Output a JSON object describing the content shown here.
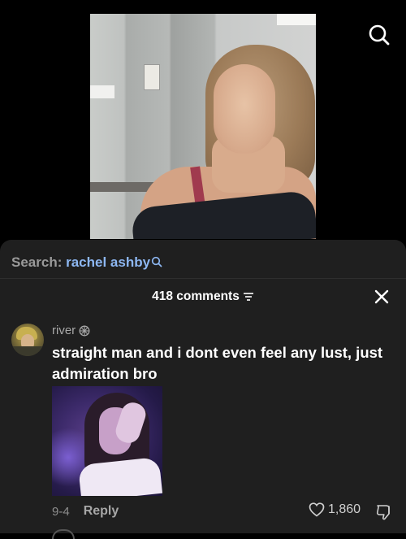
{
  "video": {
    "search_icon": "search-icon"
  },
  "panel": {
    "search_label": "Search:",
    "search_term": "rachel ashby",
    "comments_count": "418 comments",
    "filter_icon": "sort-icon",
    "close_icon": "close-icon"
  },
  "comment": {
    "username": "river",
    "badge_icon": "flower-badge-icon",
    "text": "straight man and i dont even feel any lust, just admiration bro",
    "date": "9-4",
    "reply_label": "Reply",
    "likes": "1,860",
    "like_icon": "heart-icon",
    "dislike_icon": "thumbs-down-icon"
  },
  "colors": {
    "background": "#000000",
    "panel": "#1f1f1f",
    "search_term": "#8db7f2",
    "text_primary": "#ffffff",
    "text_secondary": "#8e8e8e"
  }
}
